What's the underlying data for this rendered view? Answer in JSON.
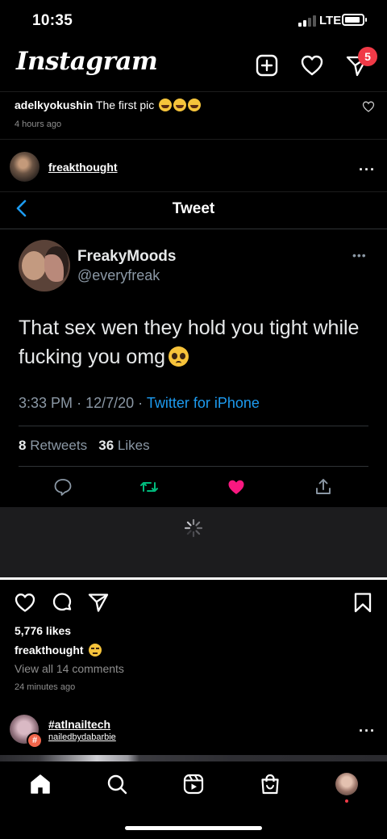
{
  "status_bar": {
    "time": "10:35",
    "network": "LTE"
  },
  "header": {
    "logo": "Instagram",
    "icons": [
      "new-post-icon",
      "heart-icon",
      "direct-message-icon"
    ],
    "dm_badge_count": "5",
    "badge_color": "#f03a47"
  },
  "previous_post": {
    "username": "adelkyokushin",
    "caption": "The first pic",
    "caption_emojis": [
      "laughing-tears",
      "laughing-tears",
      "laughing-tears"
    ],
    "time": "4 hours ago"
  },
  "post": {
    "username": "freakthought",
    "more_icon": "more-dots-icon"
  },
  "tweet": {
    "nav_title": "Tweet",
    "name": "FreakyMoods",
    "handle": "@everyfreak",
    "text": "That sex wen they hold you tight while fucking you omg",
    "text_emoji": "pleading-face",
    "time": "3:33 PM",
    "date": "12/7/20",
    "separator": "·",
    "source": "Twitter for iPhone",
    "retweets_count": "8",
    "retweets_label": "Retweets",
    "likes_count": "36",
    "likes_label": "Likes",
    "actions": [
      "reply-icon",
      "retweet-icon",
      "like-icon",
      "share-icon"
    ],
    "colors": {
      "link": "#1d9bf0",
      "retweet": "#00ba7c",
      "like": "#f91880",
      "muted": "#8b98a5"
    }
  },
  "post_actions": {
    "icons": [
      "like-icon",
      "comment-icon",
      "share-icon",
      "save-icon"
    ],
    "likes": "5,776 likes",
    "caption_user": "freakthought",
    "caption_emoji": "unamused-face",
    "view_comments": "View all 14 comments",
    "time": "24 minutes ago"
  },
  "next_post": {
    "hashtag": "#atlnailtech",
    "username": "nailedbydabarbie",
    "badge": "#"
  },
  "tab_bar": {
    "tabs": [
      "home-icon",
      "search-icon",
      "reels-icon",
      "shop-icon",
      "profile-avatar"
    ]
  }
}
